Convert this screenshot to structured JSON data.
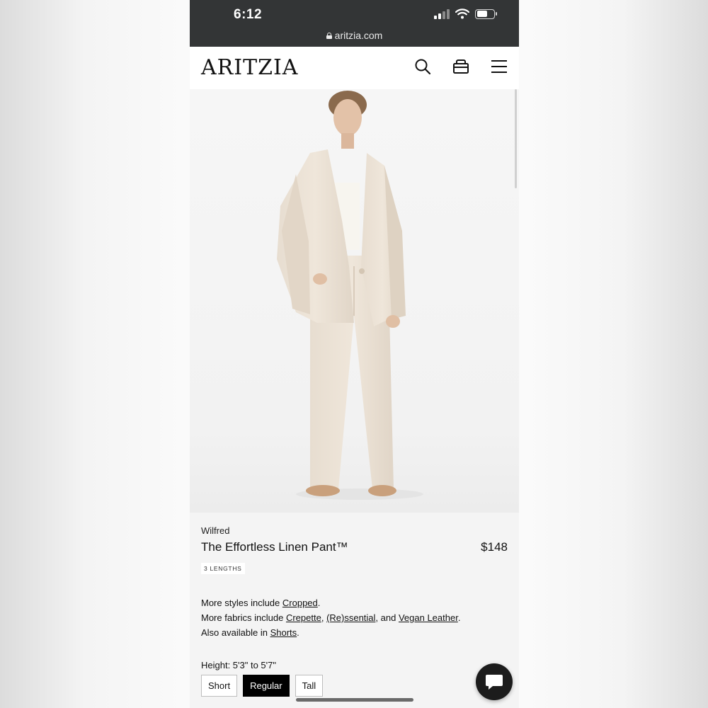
{
  "status": {
    "time": "6:12",
    "url": "aritzia.com"
  },
  "header": {
    "logo": "ARITZIA"
  },
  "icons": {
    "search": "search-icon",
    "bag": "bag-icon",
    "menu": "menu-icon",
    "chat": "chat-icon",
    "lock": "lock-icon"
  },
  "product": {
    "brand": "Wilfred",
    "title": "The Effortless Linen Pant™",
    "price": "$148",
    "badge": "3 LENGTHS",
    "more_styles_prefix": "More styles include ",
    "more_styles_link": "Cropped",
    "more_fabrics_prefix": "More fabrics include ",
    "fabrics": [
      "Crepette",
      "(Re)ssential",
      "Vegan Leather"
    ],
    "fabrics_sep1": ", ",
    "fabrics_sep2": ", and ",
    "also_prefix": "Also available in ",
    "also_link": "Shorts",
    "period": "."
  },
  "size": {
    "height_label": "Height: 5'3\" to 5'7\"",
    "options": [
      "Short",
      "Regular",
      "Tall"
    ],
    "selected": "Regular"
  },
  "colors": {
    "status_bar": "#333536",
    "accent": "#000000",
    "background": "#f4f4f4"
  }
}
